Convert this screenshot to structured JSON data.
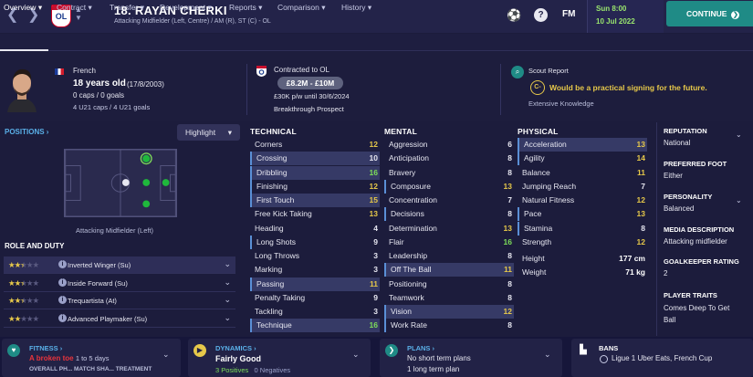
{
  "topbar": {
    "player_name": "18. RAYAN CHERKI",
    "player_positions": "Attacking Midfielder (Left, Centre) / AM (R), ST (C) - OL",
    "club_badge_text": "OL",
    "fm_label": "FM",
    "date_day": "Sun 8:00",
    "date_date": "10 Jul 2022",
    "continue_label": "CONTINUE",
    "icons": [
      "back-arrow-icon",
      "forward-arrow-icon",
      "club-badge",
      "player-switch-icon",
      "trophy-icon",
      "help-icon",
      "fm-logo",
      "continue-arrow-icon"
    ]
  },
  "tabs": [
    {
      "label": "Overview",
      "has_menu": true
    },
    {
      "label": "Contract",
      "has_menu": true
    },
    {
      "label": "Transfer",
      "has_menu": true
    },
    {
      "label": "Development",
      "has_menu": true
    },
    {
      "label": "Reports",
      "has_menu": true
    },
    {
      "label": "Comparison",
      "has_menu": true
    },
    {
      "label": "History",
      "has_menu": true
    }
  ],
  "tab_chevron": "▾",
  "info": {
    "nationality": "French",
    "age": "18 years old",
    "dob": "(17/8/2003)",
    "caps": "0 caps / 0 goals",
    "u21": "4 U21 caps / 4 U21 goals",
    "contract": "Contracted to OL",
    "value": "£8.2M - £10M",
    "wage": "£30K p/w until 30/6/2024",
    "prospect": "Breakthrough Prospect",
    "scout_title": "Scout Report",
    "scout_grade": "C-",
    "scout_text": "Would be a practical signing for the future.",
    "knowledge": "Extensive Knowledge"
  },
  "positions": {
    "title": "POSITIONS",
    "highlight_label": "Highlight",
    "pitch_label": "Attacking Midfielder (Left)"
  },
  "roles": {
    "title": "ROLE AND DUTY",
    "items": [
      {
        "name": "Inverted Winger (Su)",
        "stars": 2.5,
        "selected": true
      },
      {
        "name": "Inside Forward (Su)",
        "stars": 2.5,
        "selected": false
      },
      {
        "name": "Trequartista (At)",
        "stars": 2.5,
        "selected": false
      },
      {
        "name": "Advanced Playmaker (Su)",
        "stars": 2,
        "selected": false
      }
    ]
  },
  "technical": {
    "title": "TECHNICAL",
    "attrs": [
      {
        "name": "Corners",
        "value": "12",
        "hl": false,
        "key": false
      },
      {
        "name": "Crossing",
        "value": "10",
        "hl": true,
        "key": true
      },
      {
        "name": "Dribbling",
        "value": "16",
        "hl": true,
        "key": true
      },
      {
        "name": "Finishing",
        "value": "12",
        "hl": false,
        "key": true
      },
      {
        "name": "First Touch",
        "value": "15",
        "hl": true,
        "key": true
      },
      {
        "name": "Free Kick Taking",
        "value": "13",
        "hl": false,
        "key": false
      },
      {
        "name": "Heading",
        "value": "4",
        "hl": false,
        "key": false
      },
      {
        "name": "Long Shots",
        "value": "9",
        "hl": false,
        "key": true
      },
      {
        "name": "Long Throws",
        "value": "3",
        "hl": false,
        "key": false
      },
      {
        "name": "Marking",
        "value": "3",
        "hl": false,
        "key": false
      },
      {
        "name": "Passing",
        "value": "11",
        "hl": true,
        "key": true
      },
      {
        "name": "Penalty Taking",
        "value": "9",
        "hl": false,
        "key": false
      },
      {
        "name": "Tackling",
        "value": "3",
        "hl": false,
        "key": false
      },
      {
        "name": "Technique",
        "value": "16",
        "hl": true,
        "key": true
      }
    ]
  },
  "mental": {
    "title": "MENTAL",
    "attrs": [
      {
        "name": "Aggression",
        "value": "6",
        "hl": false,
        "key": false
      },
      {
        "name": "Anticipation",
        "value": "8",
        "hl": false,
        "key": false
      },
      {
        "name": "Bravery",
        "value": "8",
        "hl": false,
        "key": false
      },
      {
        "name": "Composure",
        "value": "13",
        "hl": false,
        "key": true
      },
      {
        "name": "Concentration",
        "value": "7",
        "hl": false,
        "key": false
      },
      {
        "name": "Decisions",
        "value": "8",
        "hl": false,
        "key": true
      },
      {
        "name": "Determination",
        "value": "13",
        "hl": false,
        "key": false
      },
      {
        "name": "Flair",
        "value": "16",
        "hl": false,
        "key": false
      },
      {
        "name": "Leadership",
        "value": "8",
        "hl": false,
        "key": false
      },
      {
        "name": "Off The Ball",
        "value": "11",
        "hl": true,
        "key": true
      },
      {
        "name": "Positioning",
        "value": "8",
        "hl": false,
        "key": false
      },
      {
        "name": "Teamwork",
        "value": "8",
        "hl": false,
        "key": false
      },
      {
        "name": "Vision",
        "value": "12",
        "hl": true,
        "key": true
      },
      {
        "name": "Work Rate",
        "value": "8",
        "hl": false,
        "key": true
      }
    ]
  },
  "physical": {
    "title": "PHYSICAL",
    "attrs": [
      {
        "name": "Acceleration",
        "value": "13",
        "hl": true,
        "key": true
      },
      {
        "name": "Agility",
        "value": "14",
        "hl": false,
        "key": true
      },
      {
        "name": "Balance",
        "value": "11",
        "hl": false,
        "key": false
      },
      {
        "name": "Jumping Reach",
        "value": "7",
        "hl": false,
        "key": false
      },
      {
        "name": "Natural Fitness",
        "value": "12",
        "hl": false,
        "key": false
      },
      {
        "name": "Pace",
        "value": "13",
        "hl": false,
        "key": true
      },
      {
        "name": "Stamina",
        "value": "8",
        "hl": false,
        "key": true
      },
      {
        "name": "Strength",
        "value": "12",
        "hl": false,
        "key": false
      }
    ],
    "height_label": "Height",
    "height": "177 cm",
    "weight_label": "Weight",
    "weight": "71 kg"
  },
  "side": {
    "reputation_title": "REPUTATION",
    "reputation": "National",
    "foot_title": "PREFERRED FOOT",
    "foot": "Either",
    "personality_title": "PERSONALITY",
    "personality": "Balanced",
    "media_title": "MEDIA DESCRIPTION",
    "media": "Attacking midfielder",
    "gk_title": "GOALKEEPER RATING",
    "gk": "2",
    "traits_title": "PLAYER TRAITS",
    "trait1": "Comes Deep To Get",
    "trait2": "Ball"
  },
  "bottom": {
    "fitness_title": "FITNESS",
    "fitness_line": "A broken toe",
    "fitness_extra": "1 to 5 days",
    "fitness_cols": "OVERALL PH...   MATCH SHA...   TREATMENT",
    "dynamics_title": "DYNAMICS",
    "dynamics_line": "Fairly Good",
    "dynamics_pos": "3 Positives",
    "dynamics_neg": "0 Negatives",
    "plans_title": "PLANS",
    "plans_line1": "No short term plans",
    "plans_line2": "1 long term plan",
    "bans_title": "BANS",
    "bans_line": "Ligue 1 Uber Eats, French Cup"
  },
  "colors": {
    "accent": "#1f8b86",
    "date_green": "#9ae66e",
    "value_yellow": "#e6c84a",
    "value_green": "#7ede5a",
    "value_white": "#e6e6f0",
    "fitness_red": "#e8343c",
    "dynamics_yellow": "#e6c84a",
    "bg": "#1c1c3c"
  }
}
